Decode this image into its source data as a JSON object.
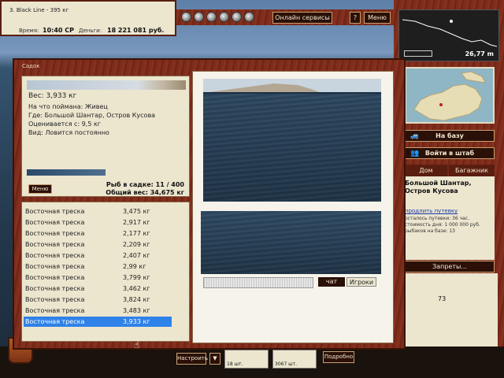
{
  "top_info": {
    "line1": "3. Black Line - 395 кг",
    "time_label": "Время:",
    "time_value": "10:40 СР",
    "money_label": "Деньги:",
    "money_value": "18 221 081 руб."
  },
  "top_bar": {
    "online_services": "Онлайн сервисы",
    "help": "?",
    "menu": "Меню"
  },
  "right_panel": {
    "distance": "26,77 m",
    "to_base": "На базу",
    "to_hq": "Войти в штаб",
    "tab_home": "Дом",
    "tab_baggage": "Багажник",
    "location_line1": "Большой Шантар,",
    "location_line2": "Остров Кусова",
    "extend_trip": "продлить путевку",
    "days_left": "осталось путевки: 36 час.",
    "cost_per_day": "стоимость дня: 1 000 000 руб.",
    "boats": "рыбаков на базе: 13",
    "bans": "Запреты...",
    "number": "73"
  },
  "dialog": {
    "title": "Садок",
    "weight": "Вес: 3,933 кг",
    "caught_on": "На что поймана: Живец",
    "where": "Где: Большой Шантар, Остров Кусова",
    "value": "Оценивается с: 9,5 кг",
    "kind": "Вид: Ловится постоянно",
    "menu_button": "Меню",
    "fish_count": "Рыб в садке: 11 / 400",
    "total_weight": "Общий вес: 34,675 кг"
  },
  "fish_list": [
    {
      "name": "Восточная треска",
      "weight": "3,475 кг",
      "selected": false
    },
    {
      "name": "Восточная треска",
      "weight": "2,917 кг",
      "selected": false
    },
    {
      "name": "Восточная треска",
      "weight": "2,177 кг",
      "selected": false
    },
    {
      "name": "Восточная треска",
      "weight": "2,209 кг",
      "selected": false
    },
    {
      "name": "Восточная треска",
      "weight": "2,407 кг",
      "selected": false
    },
    {
      "name": "Восточная треска",
      "weight": "2,99 кг",
      "selected": false
    },
    {
      "name": "Восточная треска",
      "weight": "3,799 кг",
      "selected": false
    },
    {
      "name": "Восточная треска",
      "weight": "3,462 кг",
      "selected": false
    },
    {
      "name": "Восточная треска",
      "weight": "3,824 кг",
      "selected": false
    },
    {
      "name": "Восточная треска",
      "weight": "3,483 кг",
      "selected": false
    },
    {
      "name": "Восточная треска",
      "weight": "3,933 кг",
      "selected": true
    }
  ],
  "chat": {
    "chat_tab": "чат",
    "players_tab": "Игроки"
  },
  "bottom_bar": {
    "setup": "Настроить",
    "slot1": "18 шт.",
    "slot2": "3067 шт.",
    "details": "Подробно"
  }
}
